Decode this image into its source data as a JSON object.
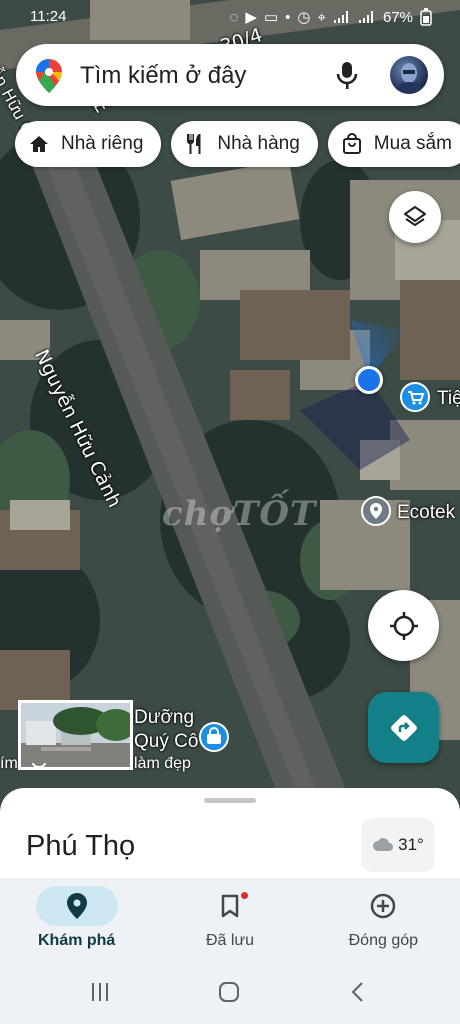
{
  "status_bar": {
    "time": "11:24",
    "battery": "67%"
  },
  "search": {
    "placeholder": "Tìm kiếm ở đây"
  },
  "chips": [
    {
      "label": "Nhà riêng",
      "icon": "home-icon"
    },
    {
      "label": "Nhà hàng",
      "icon": "restaurant-icon"
    },
    {
      "label": "Mua sắm",
      "icon": "shopping-bag-icon"
    }
  ],
  "map": {
    "streets": {
      "main": "Nguyễn Hữu Cảnh",
      "top_right": "30/4",
      "top_mid": "Hu",
      "left_edge": "yễn Hữu C"
    },
    "watermark": "chợTỐT",
    "pois": {
      "shop": {
        "label": "Tiệ"
      },
      "ecotek": {
        "label": "Ecotek"
      },
      "beauty": {
        "label": "Dưỡng",
        "label2": "Quý Cô",
        "sub": "làm đẹp",
        "left_cut": "ím"
      }
    }
  },
  "sheet": {
    "place_name": "Phú Thọ",
    "weather": "31°"
  },
  "nav": [
    {
      "label": "Khám phá",
      "icon": "explore-pin-icon",
      "active": true
    },
    {
      "label": "Đã lưu",
      "icon": "bookmark-icon",
      "active": false
    },
    {
      "label": "Đóng góp",
      "icon": "add-circle-icon",
      "active": false
    }
  ],
  "colors": {
    "accent": "#137f86",
    "location": "#1a73e8",
    "nav_bg": "#eef2f6",
    "active_pill": "#cde8f3"
  }
}
